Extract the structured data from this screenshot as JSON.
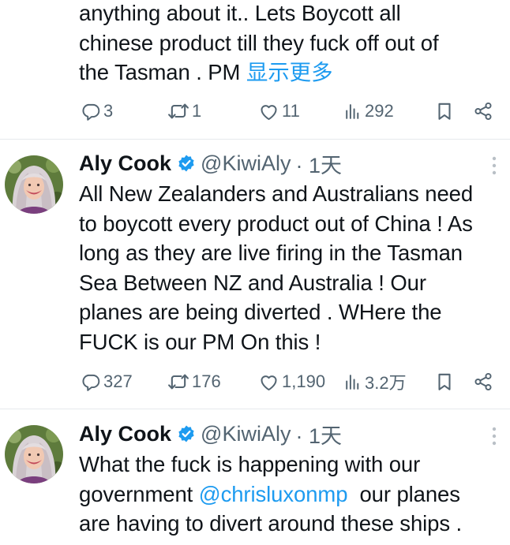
{
  "tweets": [
    {
      "text_lines": [
        "anything about it.. Lets Boycott all",
        "chinese product till they fuck off out of",
        "the Tasman . PM "
      ],
      "show_more": "显示更多",
      "stats": {
        "replies": "3",
        "reposts": "1",
        "likes": "11",
        "views": "292"
      }
    },
    {
      "name": "Aly Cook",
      "handle": "@KiwiAly",
      "time": "· 1天",
      "text_lines": [
        "All New Zealanders and Australians need",
        "to boycott every product out of China ! As",
        "long as they are live firing in the Tasman",
        "Sea Between NZ and Australia ! Our",
        "planes are being diverted . WHere the",
        "FUCK is our PM On this !"
      ],
      "stats": {
        "replies": "327",
        "reposts": "176",
        "likes": "1,190",
        "views": "3.2万"
      }
    },
    {
      "name": "Aly Cook",
      "handle": "@KiwiAly",
      "time": "· 1天",
      "line1": "What the fuck is happening with our",
      "line2_pre": "government ",
      "mention": "@chrisluxonmp",
      "line2_post": "  our planes",
      "line3": "are having to divert around these ships ."
    }
  ],
  "icons": [
    "reply-icon",
    "repost-icon",
    "like-icon",
    "views-icon",
    "bookmark-icon",
    "share-icon",
    "verified-badge-icon",
    "more-options-icon"
  ],
  "colors": {
    "text": "#0f1419",
    "secondary": "#536471",
    "link": "#1d9bf0",
    "verified": "#1d9bf0",
    "divider": "#e6e9ec"
  }
}
